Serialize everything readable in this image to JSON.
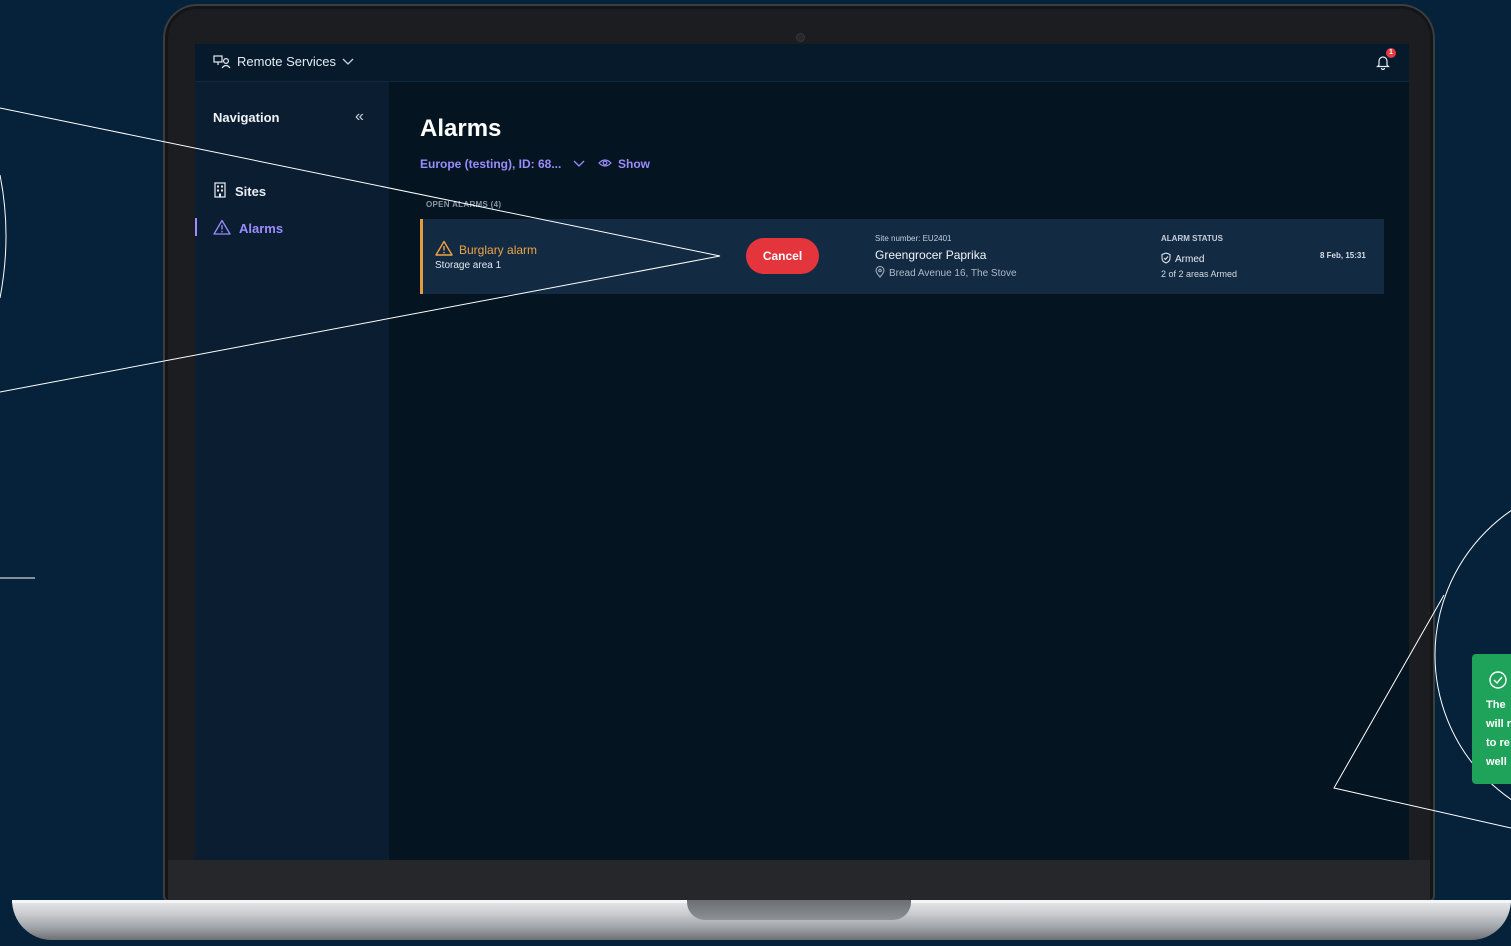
{
  "app": {
    "switcher_label": "Remote Services",
    "notification_count": "1"
  },
  "sidebar": {
    "title": "Navigation",
    "items": [
      {
        "label": "Sites",
        "icon": "building-icon",
        "active": false
      },
      {
        "label": "Alarms",
        "icon": "warning-triangle-icon",
        "active": true
      }
    ]
  },
  "main": {
    "title": "Alarms",
    "filter_label": "Europe (testing), ID: 68...",
    "show_label": "Show",
    "section_label": "OPEN ALARMS (4)"
  },
  "alarm": {
    "type": "Burglary alarm",
    "area": "Storage area 1",
    "cancel_label": "Cancel",
    "site_number": "Site number: EU2401",
    "site_name": "Greengrocer Paprika",
    "address": "Bread Avenue 16, The Stove",
    "status_heading": "ALARM STATUS",
    "status": "Armed",
    "status_detail": "2 of 2 areas Armed",
    "time": "8 Feb, 15:31"
  },
  "toast": {
    "lines": [
      "The",
      "will r",
      "to re",
      "well"
    ]
  },
  "colors": {
    "background": "#05223a",
    "accent": "#9b8cff",
    "alarm_orange": "#f0a345",
    "cancel_red": "#e4353d",
    "toast_green": "#1fa35b"
  }
}
